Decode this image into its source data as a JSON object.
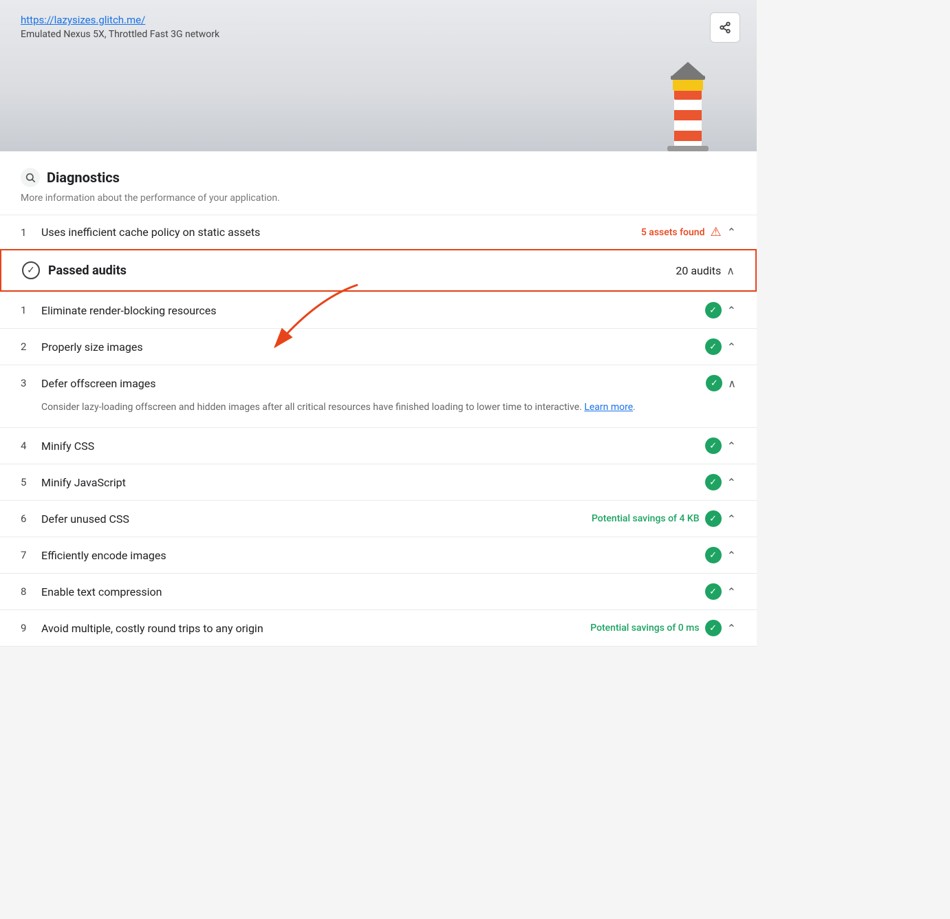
{
  "header": {
    "url": "https://lazysizes.glitch.me/",
    "subtitle": "Emulated Nexus 5X, Throttled Fast 3G network",
    "share_label": "⋮"
  },
  "diagnostics": {
    "icon": "🔍",
    "title": "Diagnostics",
    "subtitle": "More information about the performance of your application."
  },
  "diagnostics_items": [
    {
      "number": "1",
      "name": "Uses inefficient cache policy on static assets",
      "badge": "5 assets found",
      "badge_type": "warning",
      "expanded": false
    }
  ],
  "passed_audits": {
    "title": "Passed audits",
    "count": "20 audits",
    "chevron": "up"
  },
  "audit_items": [
    {
      "number": "1",
      "name": "Eliminate render-blocking resources",
      "status": "pass",
      "expanded": false
    },
    {
      "number": "2",
      "name": "Properly size images",
      "status": "pass",
      "expanded": false
    },
    {
      "number": "3",
      "name": "Defer offscreen images",
      "status": "pass",
      "expanded": true,
      "description": "Consider lazy-loading offscreen and hidden images after all critical resources have finished loading to lower time to interactive.",
      "learn_more": "Learn more"
    },
    {
      "number": "4",
      "name": "Minify CSS",
      "status": "pass",
      "expanded": false
    },
    {
      "number": "5",
      "name": "Minify JavaScript",
      "status": "pass",
      "expanded": false
    },
    {
      "number": "6",
      "name": "Defer unused CSS",
      "status": "pass",
      "savings": "Potential savings of 4 KB",
      "expanded": false
    },
    {
      "number": "7",
      "name": "Efficiently encode images",
      "status": "pass",
      "expanded": false
    },
    {
      "number": "8",
      "name": "Enable text compression",
      "status": "pass",
      "expanded": false
    },
    {
      "number": "9",
      "name": "Avoid multiple, costly round trips to any origin",
      "status": "pass",
      "savings": "Potential savings of 0 ms",
      "expanded": false
    }
  ],
  "colors": {
    "warning": "#e8441a",
    "pass": "#1ea362",
    "text_primary": "#202124",
    "text_secondary": "#666",
    "border": "#e8eaed"
  }
}
